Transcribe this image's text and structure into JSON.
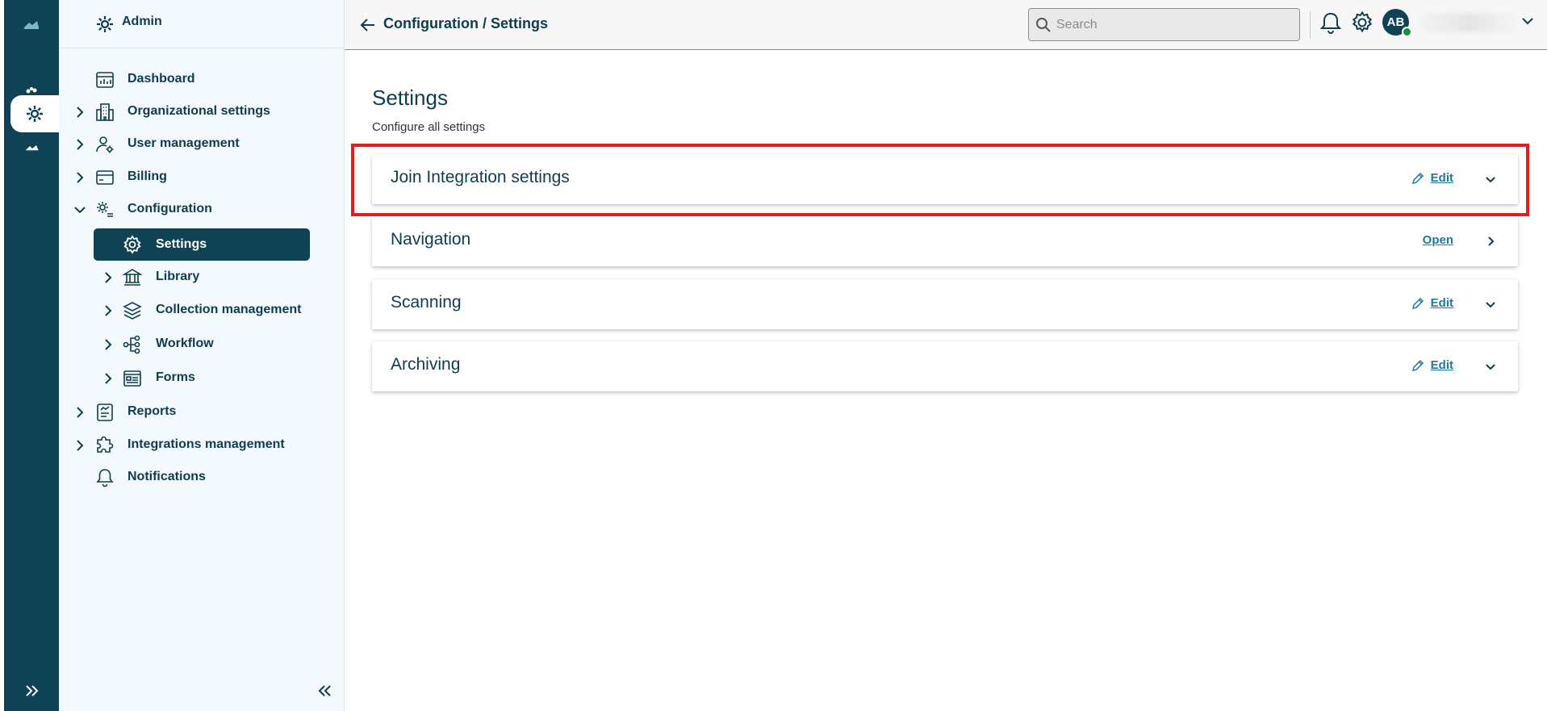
{
  "sidebar": {
    "header_title": "Admin",
    "items": [
      {
        "label": "Dashboard"
      },
      {
        "label": "Organizational settings"
      },
      {
        "label": "User management"
      },
      {
        "label": "Billing"
      },
      {
        "label": "Configuration"
      },
      {
        "label": "Settings"
      },
      {
        "label": "Library"
      },
      {
        "label": "Collection management"
      },
      {
        "label": "Workflow"
      },
      {
        "label": "Forms"
      },
      {
        "label": "Reports"
      },
      {
        "label": "Integrations management"
      },
      {
        "label": "Notifications"
      }
    ]
  },
  "topbar": {
    "breadcrumb": "Configuration / Settings",
    "search_placeholder": "Search",
    "avatar_initials": "AB"
  },
  "main": {
    "title": "Settings",
    "subtitle": "Configure all settings",
    "cards": [
      {
        "title": "Join Integration settings",
        "action": "Edit"
      },
      {
        "title": "Navigation",
        "action": "Open"
      },
      {
        "title": "Scanning",
        "action": "Edit"
      },
      {
        "title": "Archiving",
        "action": "Edit"
      }
    ]
  },
  "colors": {
    "brand_dark": "#0e4254",
    "link": "#1f7a9e",
    "highlight": "#e02020",
    "presence": "#1f8a3a"
  }
}
